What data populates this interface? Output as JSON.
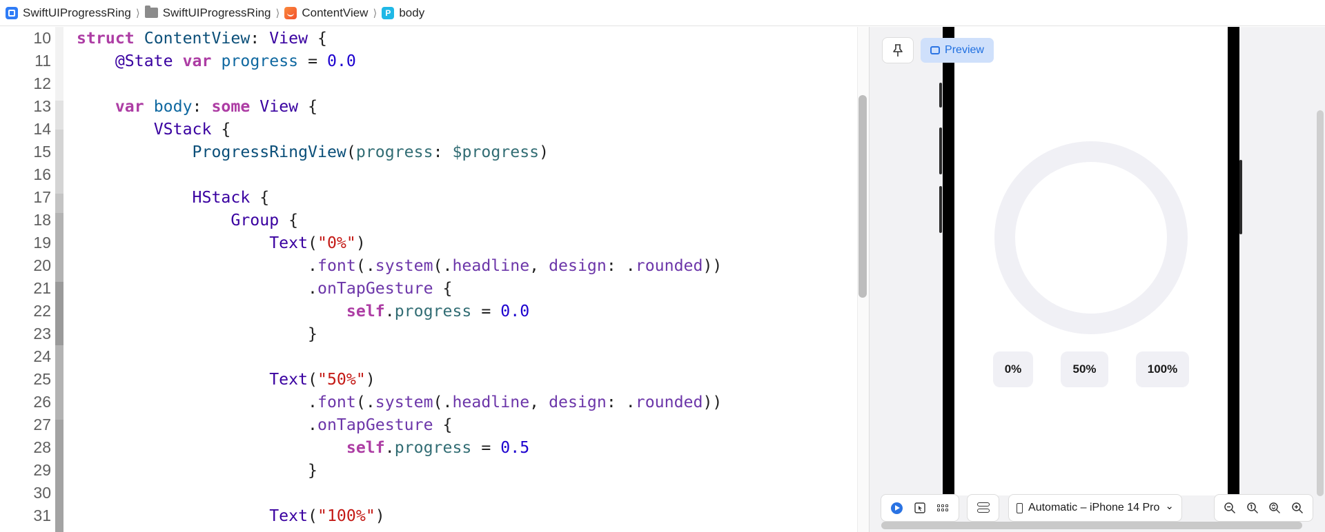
{
  "breadcrumb": {
    "items": [
      {
        "label": "SwiftUIProgressRing",
        "icon": "app-icon"
      },
      {
        "label": "SwiftUIProgressRing",
        "icon": "folder-icon"
      },
      {
        "label": "ContentView",
        "icon": "swift-file-icon"
      },
      {
        "label": "body",
        "icon": "property-icon"
      }
    ],
    "separator": "⟩"
  },
  "editor": {
    "lines": [
      {
        "n": "10",
        "tokens": [
          [
            "kw",
            "struct"
          ],
          [
            "p",
            " "
          ],
          [
            "tp",
            "ContentView"
          ],
          [
            "p",
            ": "
          ],
          [
            "ty",
            "View"
          ],
          [
            "p",
            " {"
          ]
        ]
      },
      {
        "n": "11",
        "tokens": [
          [
            "p",
            "    "
          ],
          [
            "ty",
            "@State"
          ],
          [
            "p",
            " "
          ],
          [
            "kw",
            "var"
          ],
          [
            "p",
            " "
          ],
          [
            "dc",
            "progress"
          ],
          [
            "p",
            " = "
          ],
          [
            "num",
            "0.0"
          ]
        ]
      },
      {
        "n": "12",
        "tokens": []
      },
      {
        "n": "13",
        "tokens": [
          [
            "p",
            "    "
          ],
          [
            "kw",
            "var"
          ],
          [
            "p",
            " "
          ],
          [
            "dc",
            "body"
          ],
          [
            "p",
            ": "
          ],
          [
            "kw",
            "some"
          ],
          [
            "p",
            " "
          ],
          [
            "ty",
            "View"
          ],
          [
            "p",
            " {"
          ]
        ]
      },
      {
        "n": "14",
        "tokens": [
          [
            "p",
            "        "
          ],
          [
            "ty",
            "VStack"
          ],
          [
            "p",
            " {"
          ]
        ]
      },
      {
        "n": "15",
        "tokens": [
          [
            "p",
            "            "
          ],
          [
            "tp",
            "ProgressRingView"
          ],
          [
            "p",
            "("
          ],
          [
            "pr",
            "progress"
          ],
          [
            "p",
            ": "
          ],
          [
            "pr",
            "$progress"
          ],
          [
            "p",
            ")"
          ]
        ]
      },
      {
        "n": "16",
        "tokens": []
      },
      {
        "n": "17",
        "tokens": [
          [
            "p",
            "            "
          ],
          [
            "ty",
            "HStack"
          ],
          [
            "p",
            " {"
          ]
        ]
      },
      {
        "n": "18",
        "tokens": [
          [
            "p",
            "                "
          ],
          [
            "ty",
            "Group"
          ],
          [
            "p",
            " {"
          ]
        ]
      },
      {
        "n": "19",
        "tokens": [
          [
            "p",
            "                    "
          ],
          [
            "ty",
            "Text"
          ],
          [
            "p",
            "("
          ],
          [
            "str",
            "\"0%\""
          ],
          [
            "p",
            ")"
          ]
        ]
      },
      {
        "n": "20",
        "tokens": [
          [
            "p",
            "                        ."
          ],
          [
            "mt",
            "font"
          ],
          [
            "p",
            "(."
          ],
          [
            "mt",
            "system"
          ],
          [
            "p",
            "(."
          ],
          [
            "mt",
            "headline"
          ],
          [
            "p",
            ", "
          ],
          [
            "mt",
            "design"
          ],
          [
            "p",
            ": ."
          ],
          [
            "mt",
            "rounded"
          ],
          [
            "p",
            "))"
          ]
        ]
      },
      {
        "n": "21",
        "tokens": [
          [
            "p",
            "                        ."
          ],
          [
            "mt",
            "onTapGesture"
          ],
          [
            "p",
            " {"
          ]
        ]
      },
      {
        "n": "22",
        "tokens": [
          [
            "p",
            "                            "
          ],
          [
            "kw",
            "self"
          ],
          [
            "p",
            "."
          ],
          [
            "pr",
            "progress"
          ],
          [
            "p",
            " = "
          ],
          [
            "num",
            "0.0"
          ]
        ]
      },
      {
        "n": "23",
        "tokens": [
          [
            "p",
            "                        }"
          ]
        ]
      },
      {
        "n": "24",
        "tokens": []
      },
      {
        "n": "25",
        "tokens": [
          [
            "p",
            "                    "
          ],
          [
            "ty",
            "Text"
          ],
          [
            "p",
            "("
          ],
          [
            "str",
            "\"50%\""
          ],
          [
            "p",
            ")"
          ]
        ]
      },
      {
        "n": "26",
        "tokens": [
          [
            "p",
            "                        ."
          ],
          [
            "mt",
            "font"
          ],
          [
            "p",
            "(."
          ],
          [
            "mt",
            "system"
          ],
          [
            "p",
            "(."
          ],
          [
            "mt",
            "headline"
          ],
          [
            "p",
            ", "
          ],
          [
            "mt",
            "design"
          ],
          [
            "p",
            ": ."
          ],
          [
            "mt",
            "rounded"
          ],
          [
            "p",
            "))"
          ]
        ]
      },
      {
        "n": "27",
        "tokens": [
          [
            "p",
            "                        ."
          ],
          [
            "mt",
            "onTapGesture"
          ],
          [
            "p",
            " {"
          ]
        ]
      },
      {
        "n": "28",
        "tokens": [
          [
            "p",
            "                            "
          ],
          [
            "kw",
            "self"
          ],
          [
            "p",
            "."
          ],
          [
            "pr",
            "progress"
          ],
          [
            "p",
            " = "
          ],
          [
            "num",
            "0.5"
          ]
        ]
      },
      {
        "n": "29",
        "tokens": [
          [
            "p",
            "                        }"
          ]
        ]
      },
      {
        "n": "30",
        "tokens": []
      },
      {
        "n": "31",
        "tokens": [
          [
            "p",
            "                    "
          ],
          [
            "ty",
            "Text"
          ],
          [
            "p",
            "("
          ],
          [
            "str",
            "\"100%\""
          ],
          [
            "p",
            ")"
          ]
        ]
      }
    ],
    "colors": {
      "kw": "#ad3da4",
      "tp": "#0b4f79",
      "ty": "#3900a0",
      "dc": "#0f68a0",
      "num": "#1c00cf",
      "str": "#c41a16",
      "pr": "#326d74",
      "mt": "#6c36a9",
      "p": "#1f1f1f"
    }
  },
  "canvas": {
    "preview_tab_label": "Preview",
    "pin_icon": "pin-icon",
    "progress_buttons": [
      "0%",
      "50%",
      "100%"
    ],
    "ring_progress": 0.0,
    "device_label": "Automatic – iPhone 14 Pro",
    "device_chevron": "⌄"
  }
}
